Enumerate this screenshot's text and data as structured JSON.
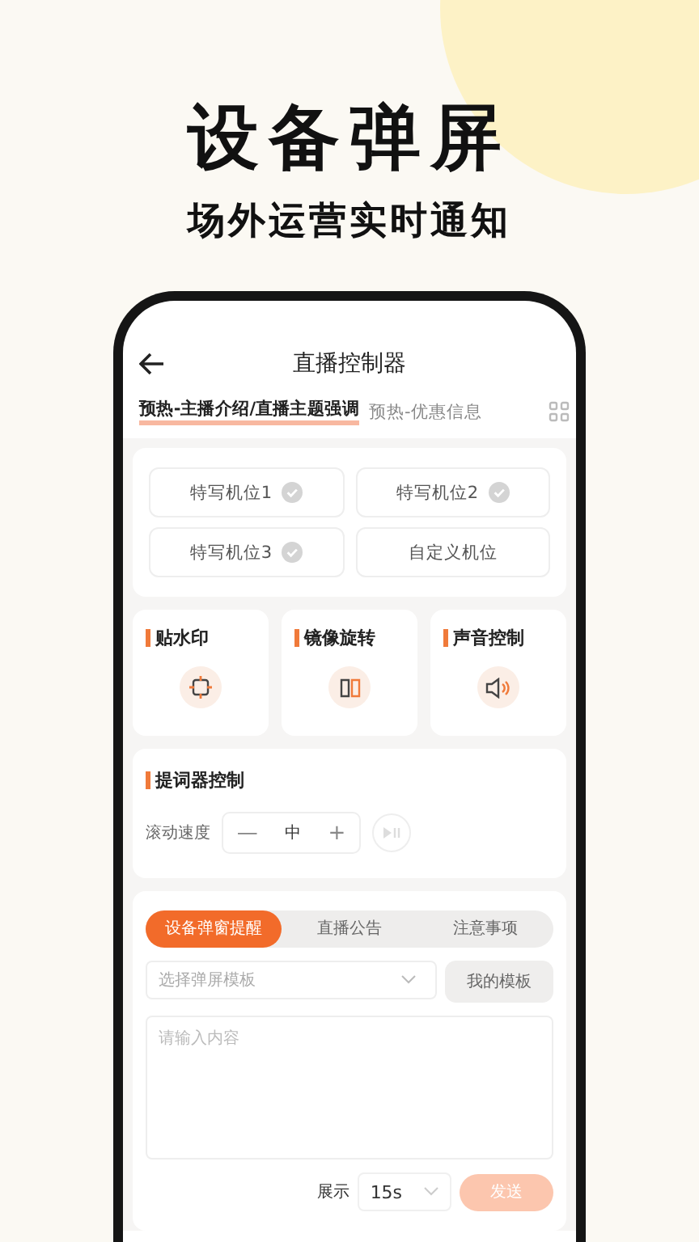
{
  "headline": "设备弹屏",
  "subtitle": "场外运营实时通知",
  "screen": {
    "title": "直播控制器",
    "tabs": [
      {
        "label": "预热-主播介绍/直播主题强调",
        "selected": true
      },
      {
        "label": "预热-优惠信息",
        "selected": false
      }
    ],
    "camera_positions": [
      {
        "label": "特写机位1",
        "kind": "preset"
      },
      {
        "label": "特写机位2",
        "kind": "preset"
      },
      {
        "label": "特写机位3",
        "kind": "preset"
      },
      {
        "label": "自定义机位",
        "kind": "custom"
      }
    ],
    "features": [
      {
        "title": "贴水印",
        "kind": "watermark"
      },
      {
        "title": "镜像旋转",
        "kind": "mirror"
      },
      {
        "title": "声音控制",
        "kind": "sound"
      }
    ],
    "teleprompter": {
      "title": "提词器控制",
      "speed_label": "滚动速度",
      "minus": "—",
      "speed": "中",
      "plus": "+"
    },
    "popup_tabs": [
      {
        "label": "设备弹窗提醒",
        "selected": true
      },
      {
        "label": "直播公告",
        "selected": false
      },
      {
        "label": "注意事项",
        "selected": false
      }
    ],
    "template_select": {
      "placeholder": "选择弹屏模板"
    },
    "my_template_button": "我的模板",
    "content_field": {
      "placeholder": "请输入内容"
    },
    "display_label": "展示",
    "display_duration": "15s",
    "send_button": {
      "label": "发送",
      "disabled": true
    }
  }
}
